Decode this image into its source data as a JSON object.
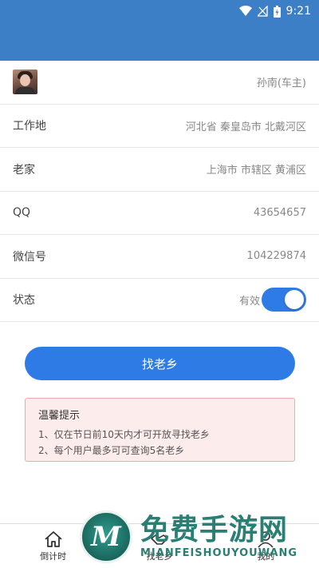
{
  "status_bar": {
    "time": "9:21"
  },
  "colors": {
    "header": "#3d7fc6",
    "accent": "#2f7be6",
    "tips_bg": "#fdecec",
    "tips_border": "#f1a8a8"
  },
  "profile": {
    "name": "孙南(车主)",
    "fields": [
      {
        "label": "工作地",
        "value": "河北省 秦皇岛市 北戴河区"
      },
      {
        "label": "老家",
        "value": "上海市 市辖区 黄浦区"
      },
      {
        "label": "QQ",
        "value": "43654657"
      },
      {
        "label": "微信号",
        "value": "104229874"
      }
    ],
    "status": {
      "label": "状态",
      "value": "有效",
      "enabled": true
    }
  },
  "find_button": {
    "label": "找老乡"
  },
  "tips": {
    "title": "温馨提示",
    "lines": [
      "1、仅在节日前10天内才可开放寻找老乡",
      "2、每个用户最多可可查询5名老乡"
    ]
  },
  "tabs": [
    {
      "label": "倒计时",
      "icon": "home-icon"
    },
    {
      "label": "找老乡",
      "icon": "handshake-icon"
    },
    {
      "label": "我的",
      "icon": "user-icon"
    }
  ],
  "watermark": {
    "logo_letter": "M",
    "text": "免费手游网",
    "text_en": "MIANFEISHOUYOUWANG"
  }
}
